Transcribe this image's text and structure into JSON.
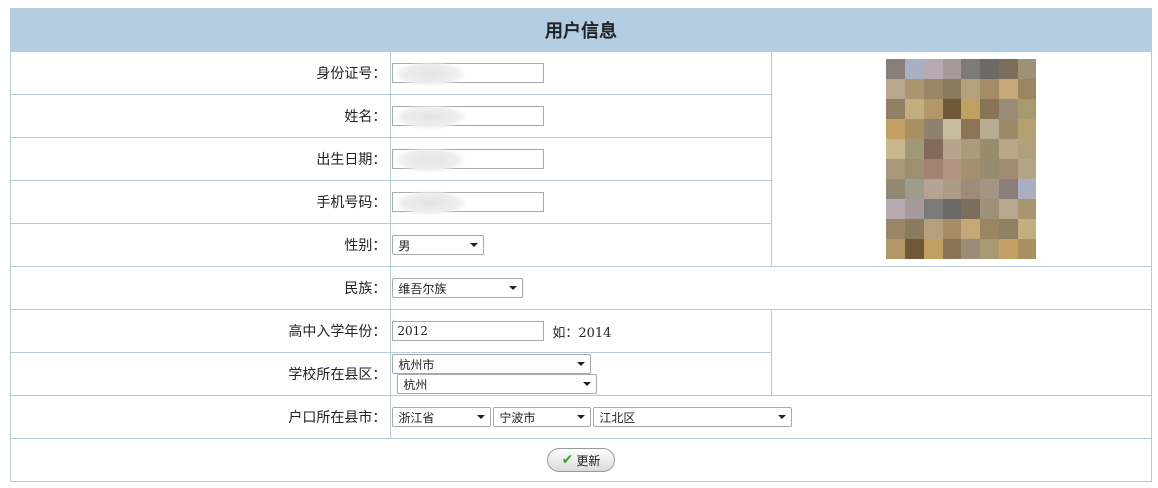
{
  "title": "用户信息",
  "fields": {
    "id_label": "身份证号：",
    "name_label": "姓名：",
    "birth_label": "出生日期：",
    "phone_label": "手机号码：",
    "gender_label": "性别：",
    "gender_value": "男",
    "ethnic_label": "民族：",
    "ethnic_value": "维吾尔族",
    "year_label": "高中入学年份：",
    "year_value": "2012",
    "year_hint": "如：2014",
    "school_label": "学校所在县区：",
    "school_city": "杭州市",
    "school_district": "杭州",
    "hukou_label": "户口所在县市：",
    "hukou_province": "浙江省",
    "hukou_city": "宁波市",
    "hukou_district": "江北区"
  },
  "update_button": "更新",
  "photo_colors": [
    "#8a7f78",
    "#a9b0c4",
    "#b7aab0",
    "#a89a9c",
    "#7d7a7a",
    "#6c6a66",
    "#7c6d5c",
    "#9e9177",
    "#b8a890",
    "#a99570",
    "#9a8566",
    "#8a7a5e",
    "#b4a07c",
    "#a58b66",
    "#c4a878",
    "#9b8460",
    "#8e8060",
    "#c2ae80",
    "#b29868",
    "#6f5838",
    "#c0a060",
    "#8a7458",
    "#9a8a78",
    "#a89a70",
    "#c4a064",
    "#a89060",
    "#908070",
    "#c8bca0",
    "#8c7458",
    "#b8ac90",
    "#9c8a68",
    "#b4a070",
    "#c8b890",
    "#a09878",
    "#846a5c",
    "#b6a48c",
    "#a89c7c",
    "#988c6c",
    "#b8a888",
    "#b0a07c",
    "#a89878",
    "#9c9070",
    "#a08470",
    "#b09480",
    "#a49070",
    "#988c70",
    "#a08c74",
    "#b4a488",
    "#908870",
    "#a09c8c",
    "#b4a494",
    "#ac9c84",
    "#9c8c78",
    "#a49484"
  ]
}
